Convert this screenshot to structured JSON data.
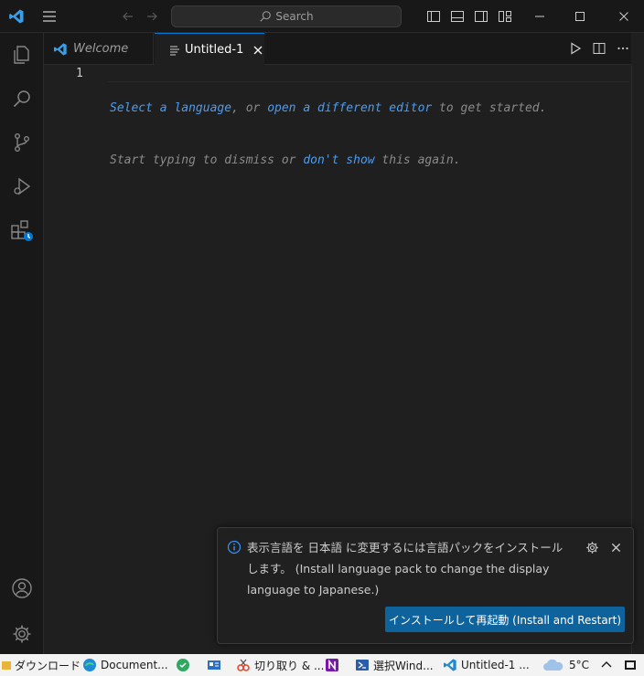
{
  "titlebar": {
    "search_label": "Search"
  },
  "tabs": [
    {
      "label": "Welcome"
    },
    {
      "label": "Untitled-1"
    }
  ],
  "editor": {
    "line_number": "1",
    "hint_line1": {
      "link1": "Select a language",
      "text1": ", or ",
      "link2": "open a different editor",
      "text2": " to get started."
    },
    "hint_line2": {
      "text1": "Start typing to dismiss or ",
      "link": "don't show",
      "text2": " this again."
    }
  },
  "notification": {
    "message_line1": "表示言語を 日本語 に変更するには言語パックをインストール",
    "message_line2": "します。 (Install language pack to change the display",
    "message_line3": "language to Japanese.)",
    "button_label": "インストールして再起動 (Install and Restart)"
  },
  "taskbar": {
    "items": [
      {
        "label": "ダウンロード"
      },
      {
        "label": "Document..."
      },
      {
        "label": "切り取り & ..."
      },
      {
        "label": "選択Wind..."
      },
      {
        "label": "Untitled-1 ..."
      }
    ],
    "temperature": "5°C"
  },
  "colors": {
    "accent": "#0078d4",
    "link": "#4d9cf0",
    "button": "#0e639c",
    "vscode_blue": "#3b9fe8"
  }
}
